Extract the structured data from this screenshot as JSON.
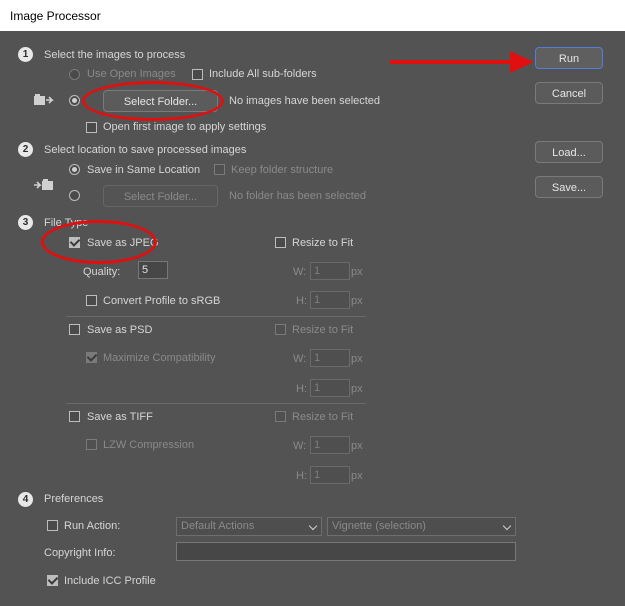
{
  "window": {
    "title": "Image Processor"
  },
  "buttons": {
    "run": "Run",
    "cancel": "Cancel",
    "load": "Load...",
    "save": "Save..."
  },
  "section1": {
    "number": "1",
    "heading": "Select the images to process",
    "use_open_images": "Use Open Images",
    "include_subfolders": "Include All sub-folders",
    "select_folder": "Select Folder...",
    "folder_status": "No images have been selected",
    "open_first_image": "Open first image to apply settings"
  },
  "section2": {
    "number": "2",
    "heading": "Select location to save processed images",
    "save_same_location": "Save in Same Location",
    "keep_structure": "Keep folder structure",
    "select_folder": "Select Folder...",
    "folder_status": "No folder has been selected"
  },
  "section3": {
    "number": "3",
    "heading": "File Type",
    "jpeg": {
      "label": "Save as JPEG",
      "checked": true,
      "resize": "Resize to Fit",
      "quality_label": "Quality:",
      "quality_value": "5",
      "convert_profile": "Convert Profile to sRGB",
      "w_label": "W:",
      "w_value": "1",
      "h_label": "H:",
      "h_value": "1",
      "unit": "px"
    },
    "psd": {
      "label": "Save as PSD",
      "checked": false,
      "resize": "Resize to Fit",
      "maximize": "Maximize Compatibility",
      "w_label": "W:",
      "w_value": "1",
      "h_label": "H:",
      "h_value": "1",
      "unit": "px"
    },
    "tiff": {
      "label": "Save as TIFF",
      "checked": false,
      "resize": "Resize to Fit",
      "lzw": "LZW Compression",
      "w_label": "W:",
      "w_value": "1",
      "h_label": "H:",
      "h_value": "1",
      "unit": "px"
    }
  },
  "section4": {
    "number": "4",
    "heading": "Preferences",
    "run_action": "Run Action:",
    "action_set": "Default Actions",
    "action": "Vignette (selection)",
    "copyright_label": "Copyright Info:",
    "copyright_value": "",
    "include_icc": "Include ICC Profile"
  },
  "colors": {
    "annotation": "#e01010",
    "dialog_bg": "#535353",
    "primary_border": "#4f7fd8"
  }
}
